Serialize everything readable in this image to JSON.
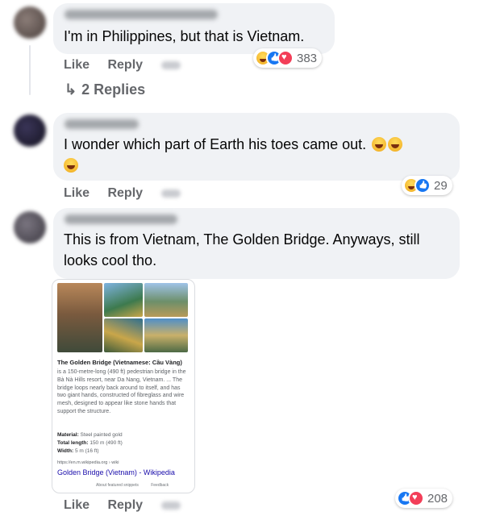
{
  "comments": [
    {
      "text": "I'm in Philippines, but that is Vietnam.",
      "like_label": "Like",
      "reply_label": "Reply",
      "reaction_count": "383",
      "reaction_types": [
        "haha",
        "like",
        "love"
      ],
      "replies_label": "2 Replies",
      "replies_icon": "reply-arrow-icon"
    },
    {
      "text": "I wonder which part of Earth his toes came out.",
      "like_label": "Like",
      "reply_label": "Reply",
      "reaction_count": "29",
      "reaction_types": [
        "haha",
        "like"
      ],
      "emoji_count": 3
    },
    {
      "text": "This is from Vietnam, The Golden Bridge. Anyways, still looks cool tho.",
      "like_label": "Like",
      "reply_label": "Reply",
      "reaction_count": "208",
      "reaction_types": [
        "like",
        "love"
      ],
      "attachment": {
        "title": "The Golden Bridge (Vietnamese: Cầu Vàng)",
        "description": "is a 150-metre-long (490 ft) pedestrian bridge in the Bà Nà Hills resort, near Da Nang, Vietnam. ... The bridge loops nearly back around to itself, and has two giant hands, constructed of fibreglass and wire mesh, designed to appear like stone hands that support the structure.",
        "facts": [
          {
            "label": "Material:",
            "value": "Steel painted gold"
          },
          {
            "label": "Total length:",
            "value": "150 m (490 ft)"
          },
          {
            "label": "Width:",
            "value": "5 m (16 ft)"
          }
        ],
        "source_url": "https://en.m.wikipedia.org › wiki",
        "source_link": "Golden Bridge (Vietnam) - Wikipedia",
        "footer_about": "About featured snippets",
        "footer_feedback": "Feedback"
      }
    }
  ],
  "colors": {
    "bubble": "#f0f2f5",
    "secondary_text": "#65676b",
    "like_blue": "#1877f2",
    "love_red": "#f33e58",
    "link": "#1a0dab"
  }
}
